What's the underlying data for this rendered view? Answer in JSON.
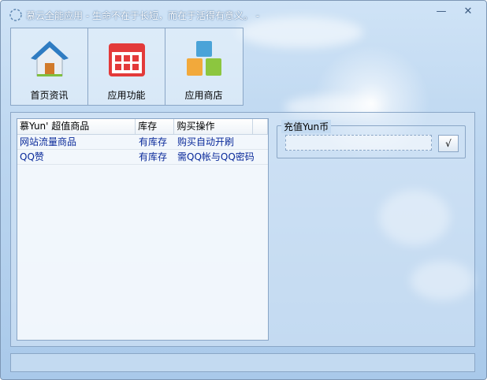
{
  "window": {
    "title": "慕云全能应用 - 生命不在于长短，而在于活得有意义。 -",
    "minimize_glyph": "—",
    "close_glyph": "✕",
    "accent_color": "#a9c9ea"
  },
  "toolbar": {
    "items": [
      {
        "label": "首页资讯",
        "icon": "home-icon"
      },
      {
        "label": "应用功能",
        "icon": "app-grid-icon"
      },
      {
        "label": "应用商店",
        "icon": "blocks-icon"
      }
    ]
  },
  "product_list": {
    "columns": [
      "慕Yun' 超值商品",
      "库存",
      "购买操作",
      ""
    ],
    "rows": [
      {
        "name": "网站流量商品",
        "stock": "有库存",
        "action": "购买自动开刷"
      },
      {
        "name": "QQ赞",
        "stock": "有库存",
        "action": "需QQ帐与QQ密码"
      }
    ]
  },
  "recharge": {
    "title": "充值Yun币",
    "input_value": "",
    "confirm_label": "√"
  },
  "statusbar": {
    "text": ""
  }
}
